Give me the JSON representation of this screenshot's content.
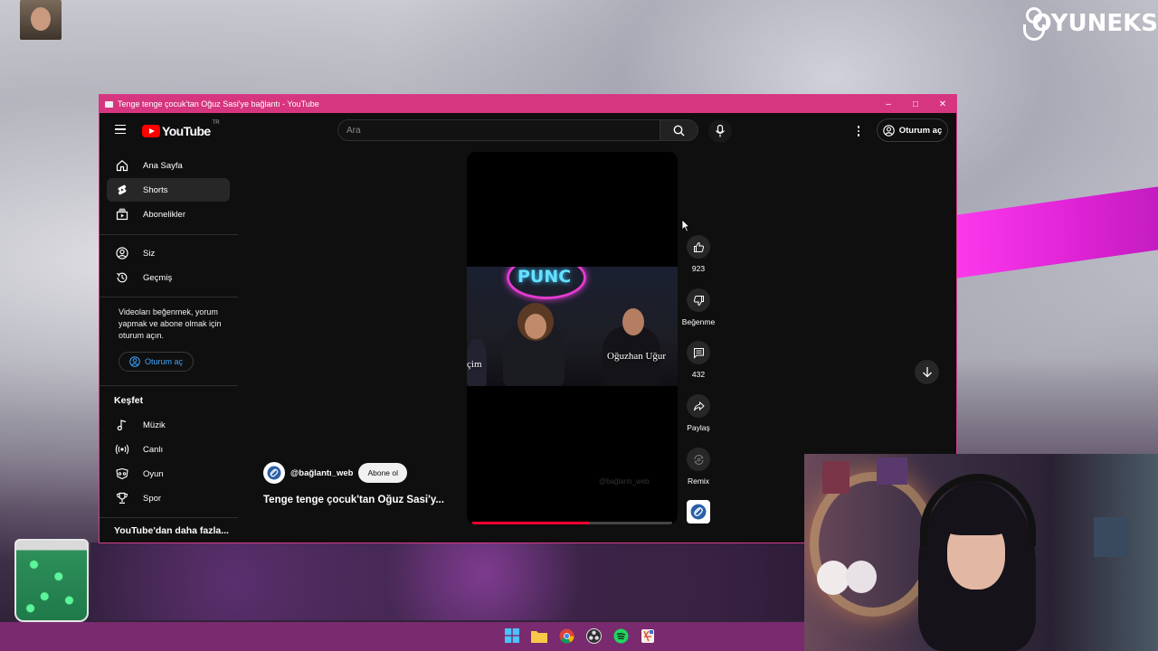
{
  "window": {
    "title": "Tenge tenge çocuk'tan Oğuz Sasi'ye bağlantı - YouTube",
    "minimize": "–",
    "maximize": "□",
    "close": "✕"
  },
  "brand": {
    "text": "OYUNEKS"
  },
  "header": {
    "logo_text": "YouTube",
    "logo_region": "TR",
    "search_placeholder": "Ara",
    "signin_label": "Oturum aç"
  },
  "sidebar": {
    "items": [
      {
        "label": "Ana Sayfa",
        "icon": "home-icon"
      },
      {
        "label": "Shorts",
        "icon": "shorts-icon",
        "active": true
      },
      {
        "label": "Abonelikler",
        "icon": "subscriptions-icon"
      }
    ],
    "you_items": [
      {
        "label": "Siz",
        "icon": "account-icon"
      },
      {
        "label": "Geçmiş",
        "icon": "history-icon"
      }
    ],
    "promo_text": "Videoları beğenmek, yorum yapmak ve abone olmak için oturum açın.",
    "signin_label": "Oturum aç",
    "explore_title": "Keşfet",
    "explore_items": [
      {
        "label": "Müzik",
        "icon": "music-icon"
      },
      {
        "label": "Canlı",
        "icon": "live-icon"
      },
      {
        "label": "Oyun",
        "icon": "gaming-icon"
      },
      {
        "label": "Spor",
        "icon": "trophy-icon"
      }
    ],
    "more_title": "YouTube'dan daha fazla..."
  },
  "short": {
    "overlay_name": "Oğuzhan Uğur",
    "overlay_left": "çim",
    "neon_text": "PUNC",
    "watermark": "@bağlantı_web",
    "progress": 0.59,
    "channel": "@bağlantı_web",
    "subscribe_label": "Abone ol",
    "title": "Tenge tenge çocuk'tan Oğuz Sasi'y...",
    "likes": "923",
    "dislike_label": "Beğenme",
    "comments": "432",
    "share_label": "Paylaş",
    "remix_label": "Remix"
  },
  "colors": {
    "titlebar": "#d6357f",
    "yt_red": "#ff0000",
    "link_blue": "#3ea6ff"
  }
}
